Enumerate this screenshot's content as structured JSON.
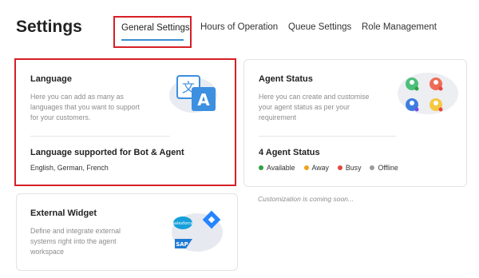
{
  "header": {
    "title": "Settings"
  },
  "tabs": [
    {
      "label": "General Settings",
      "active": true
    },
    {
      "label": "Hours of Operation",
      "active": false
    },
    {
      "label": "Queue Settings",
      "active": false
    },
    {
      "label": "Role Management",
      "active": false
    }
  ],
  "cards": {
    "language": {
      "title": "Language",
      "description_lines": [
        "Here you can add as many as",
        "languages that you want to support",
        "for your customers."
      ],
      "subtitle": "Language supported for Bot & Agent",
      "languages": "English, German, French",
      "icon": "translate-icon"
    },
    "agent_status": {
      "title": "Agent Status",
      "description_lines": [
        "Here you can create and customise",
        "your agent status as per your",
        "requirement"
      ],
      "subtitle": "4 Agent Status",
      "statuses": [
        {
          "label": "Available",
          "color": "#2ea043"
        },
        {
          "label": "Away",
          "color": "#f0a21b"
        },
        {
          "label": "Busy",
          "color": "#e0483e"
        },
        {
          "label": "Offline",
          "color": "#9a9a9a"
        }
      ],
      "icon": "agent-avatars-icon",
      "footer_note": "Customization is coming soon..."
    },
    "external_widget": {
      "title": "External Widget",
      "description_lines": [
        "Define and integrate external",
        "systems right into the agent",
        "workspace"
      ],
      "icon": "integrations-icon",
      "logos": {
        "salesforce": "salesforce",
        "sap": "SAP"
      }
    }
  },
  "colors": {
    "highlight_red": "#d61f26",
    "tab_underline": "#3b8fd4",
    "translate_blue": "#3d8fe0"
  }
}
